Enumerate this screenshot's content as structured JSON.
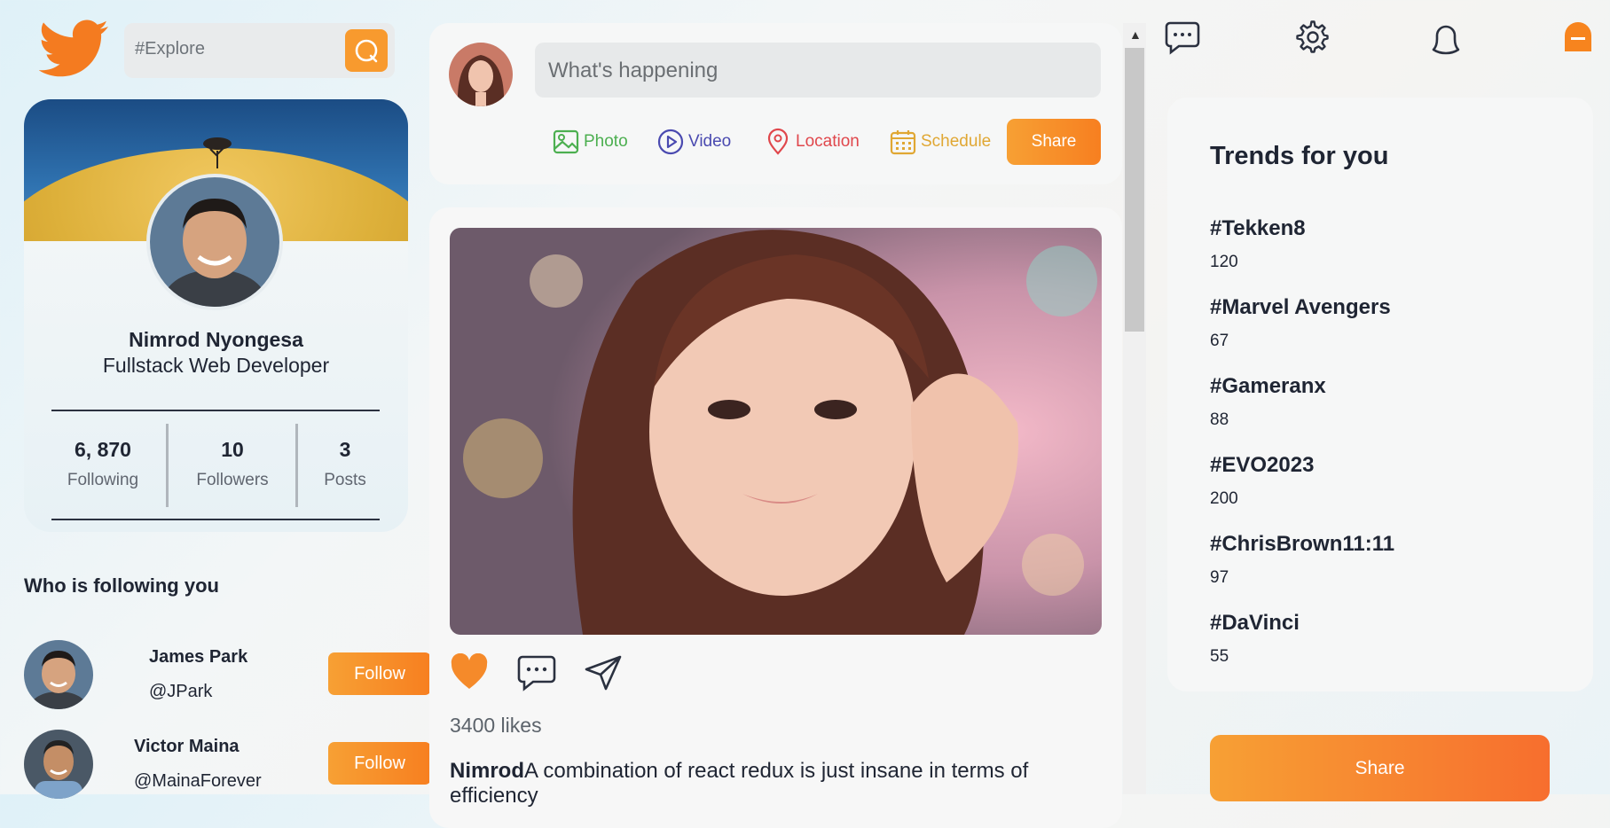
{
  "search": {
    "placeholder": "#Explore"
  },
  "profile": {
    "name": "Nimrod Nyongesa",
    "role": "Fullstack Web Developer",
    "stats": [
      {
        "value": "6, 870",
        "label": "Following"
      },
      {
        "value": "10",
        "label": "Followers"
      },
      {
        "value": "3",
        "label": "Posts"
      }
    ]
  },
  "followers_section": {
    "title": "Who is following you",
    "items": [
      {
        "name": "James Park",
        "handle": "@JPark",
        "button": "Follow"
      },
      {
        "name": "Victor Maina",
        "handle": "@MainaForever",
        "button": "Follow"
      }
    ]
  },
  "composer": {
    "placeholder": "What's happening",
    "options": [
      {
        "label": "Photo",
        "color": "#4caf50",
        "icon": "image-icon"
      },
      {
        "label": "Video",
        "color": "#4a4ab0",
        "icon": "play-circle-icon"
      },
      {
        "label": "Location",
        "color": "#e0474c",
        "icon": "location-pin-icon"
      },
      {
        "label": "Schedule",
        "color": "#e0a733",
        "icon": "calendar-icon"
      }
    ],
    "share_label": "Share"
  },
  "post": {
    "likes": "3400 likes",
    "author": "Nimrod",
    "text": "A combination of react redux is just insane in terms of efficiency"
  },
  "trends": {
    "title": "Trends for you",
    "items": [
      {
        "tag": "#Tekken8",
        "count": "120"
      },
      {
        "tag": "#Marvel Avengers",
        "count": "67"
      },
      {
        "tag": "#Gameranx",
        "count": "88"
      },
      {
        "tag": "#EVO2023",
        "count": "200"
      },
      {
        "tag": "#ChrisBrown11:11",
        "count": "97"
      },
      {
        "tag": "#DaVinci",
        "count": "55"
      }
    ]
  },
  "share_button": "Share",
  "colors": {
    "accent": "#f89a2e",
    "brand_bird": "#f47b20"
  }
}
